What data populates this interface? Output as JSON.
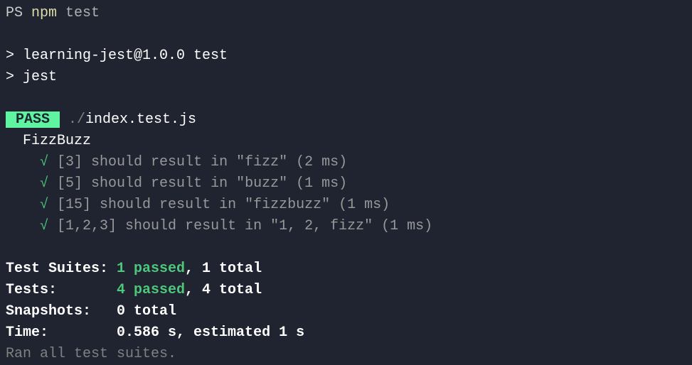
{
  "prompt": {
    "ps": "PS ",
    "cmd1": "npm",
    "cmd2": " test"
  },
  "npm": {
    "line1": "> learning-jest@1.0.0 test",
    "line2": "> jest"
  },
  "pass": {
    "badge": " PASS ",
    "file_prefix": " ./",
    "file": "index.test.js"
  },
  "suite": {
    "name": "  FizzBuzz",
    "indent": "    ",
    "check": "√",
    "tests": [
      " [3] should result in \"fizz\" (2 ms)",
      " [5] should result in \"buzz\" (1 ms)",
      " [15] should result in \"fizzbuzz\" (1 ms)",
      " [1,2,3] should result in \"1, 2, fizz\" (1 ms)"
    ]
  },
  "summary": {
    "suites_label": "Test Suites: ",
    "suites_passed": "1 passed",
    "suites_rest": ", 1 total",
    "tests_label": "Tests:       ",
    "tests_passed": "4 passed",
    "tests_rest": ", 4 total",
    "snapshots_label": "Snapshots:   ",
    "snapshots_rest": "0 total",
    "time_label": "Time:        ",
    "time_rest": "0.586 s, estimated 1 s",
    "ran": "Ran all test suites."
  }
}
